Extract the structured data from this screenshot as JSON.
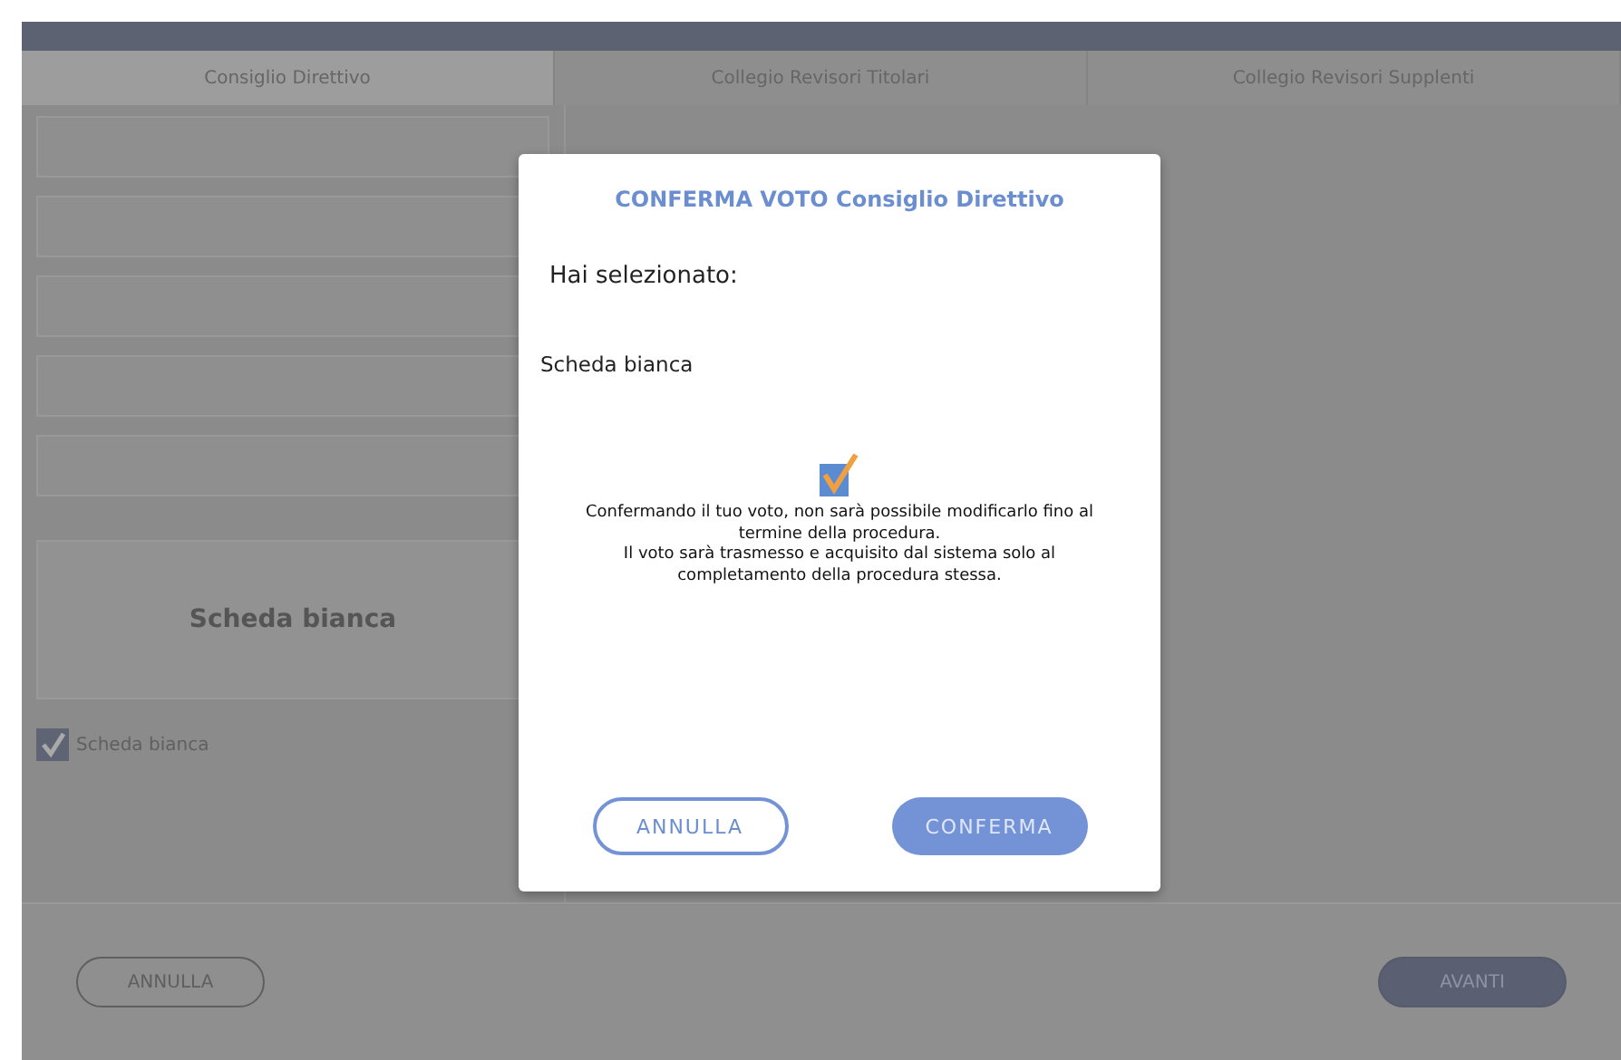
{
  "tabs": [
    {
      "label": "Consiglio Direttivo",
      "selected": true
    },
    {
      "label": "Collegio Revisori Titolari",
      "selected": false
    },
    {
      "label": "Collegio Revisori Supplenti",
      "selected": false
    }
  ],
  "ballot_card": {
    "label": "Scheda bianca"
  },
  "blank_option": {
    "label": "Scheda bianca",
    "checked": true
  },
  "footer_buttons": [
    {
      "label": "ANNULLA",
      "kind": "outline"
    },
    {
      "label": "AVANTI",
      "kind": "filled"
    }
  ],
  "dialog": {
    "title": "CONFERMA VOTO Consiglio Direttivo",
    "prompt": "Hai selezionato:",
    "choice": "Scheda bianca",
    "message": [
      "Confermando il tuo voto, non sarà possibile modificarlo fino al termine della procedura.",
      "Il voto sarà trasmesso e acquisito dal sistema solo al completamento della procedura stessa."
    ],
    "buttons": [
      {
        "label": "ANNULLA",
        "kind": "outline"
      },
      {
        "label": "CONFERMA",
        "kind": "filled"
      }
    ]
  }
}
